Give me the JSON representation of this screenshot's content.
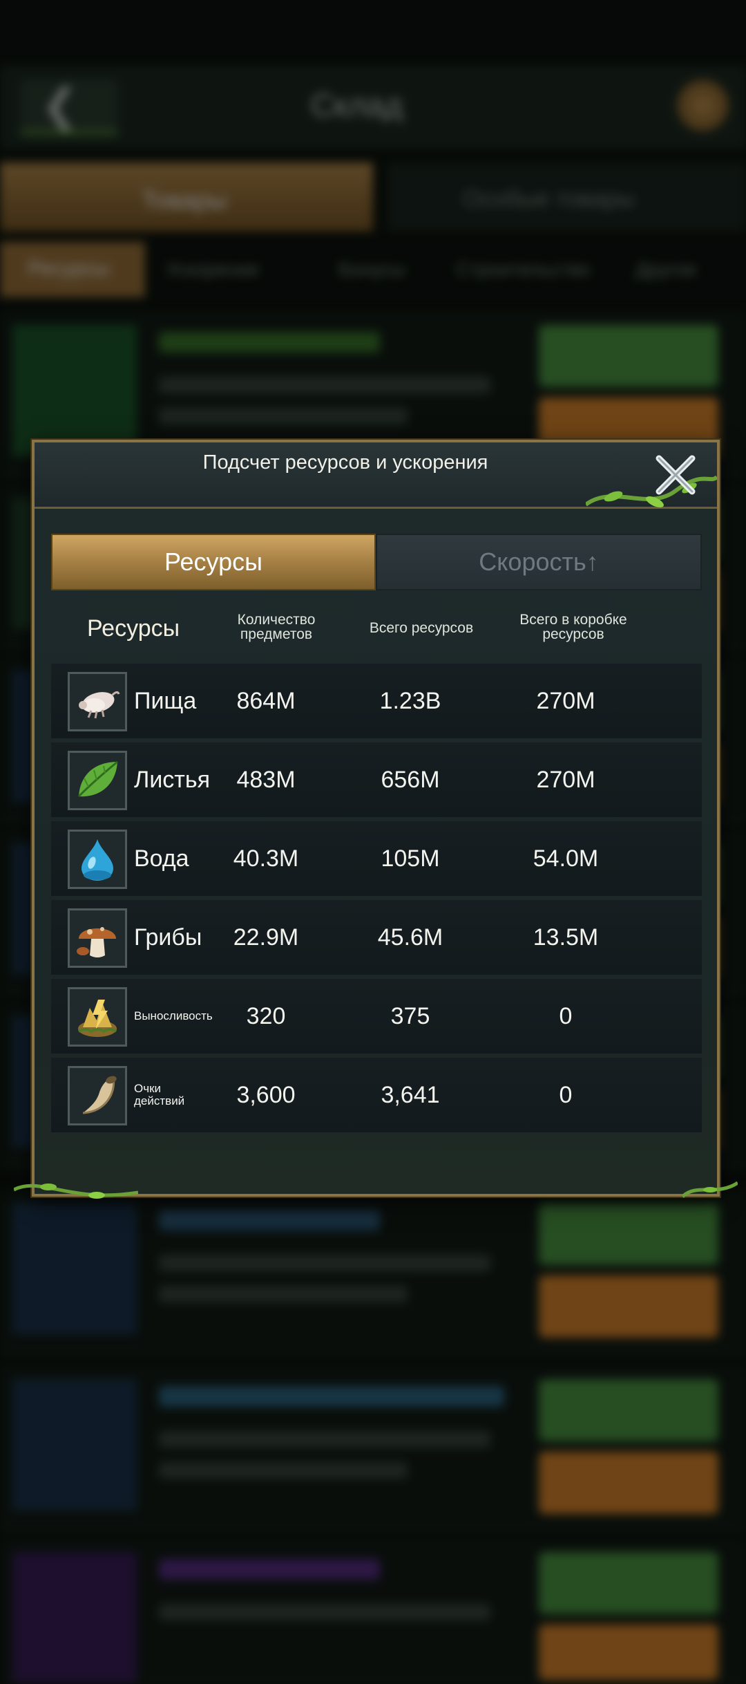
{
  "background": {
    "title": "Склад",
    "tabs": [
      "Товары",
      "Особые товары"
    ],
    "subtabs": [
      "Ресурсы",
      "Ускорение",
      "Бонусы",
      "Строительство",
      "Другое"
    ]
  },
  "dialog": {
    "title": "Подсчет ресурсов и ускорения",
    "tabs": {
      "resources": "Ресурсы",
      "speed": "Скорость↑"
    },
    "columns": {
      "resource": "Ресурсы",
      "items": "Количество предметов",
      "total": "Всего ресурсов",
      "box": "Всего в коробке ресурсов"
    },
    "rows": [
      {
        "name": "Пища",
        "icon": "food-icon",
        "items": "864M",
        "total": "1.23B",
        "box": "270M"
      },
      {
        "name": "Листья",
        "icon": "leaf-icon",
        "items": "483M",
        "total": "656M",
        "box": "270M"
      },
      {
        "name": "Вода",
        "icon": "water-drop-icon",
        "items": "40.3M",
        "total": "105M",
        "box": "54.0M"
      },
      {
        "name": "Грибы",
        "icon": "mushroom-icon",
        "items": "22.9M",
        "total": "45.6M",
        "box": "13.5M"
      },
      {
        "name": "Выносливость",
        "icon": "stamina-icon",
        "items": "320",
        "total": "375",
        "box": "0"
      },
      {
        "name": "Очки действий",
        "icon": "horn-icon",
        "items": "3,600",
        "total": "3,641",
        "box": "0"
      }
    ]
  },
  "colors": {
    "accent_gold": "#a98347",
    "panel_border": "#8b7444",
    "dialog_bg": "#1c2727"
  }
}
